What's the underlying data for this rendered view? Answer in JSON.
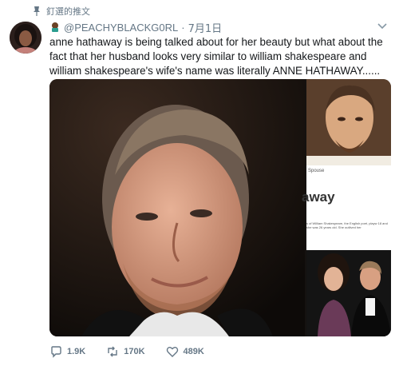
{
  "pinned": {
    "label": "釘選的推文",
    "icon": "pin-icon"
  },
  "author": {
    "handle": "@PEACHYBLACKG0RL",
    "separator": "·",
    "time": "7月1日",
    "badge": "person-emoji-icon"
  },
  "tweet": {
    "text": "anne hathaway is being talked about for her beauty but what about the fact that her husband looks very similar to william shakespeare and william shakespeare's wife's name was literally ANNE HATHAWAY......"
  },
  "media": {
    "spouse_label": "Spouse",
    "away_label": "away",
    "snippet_label": "s of William Shakespeare, the English poet, playw 18 and she was 26 years old. She outlived her"
  },
  "actions": {
    "reply_count": "1.9K",
    "retweet_count": "170K",
    "like_count": "489K"
  },
  "colors": {
    "muted": "#657786",
    "text": "#14171a",
    "accent": "#1da1f2"
  }
}
